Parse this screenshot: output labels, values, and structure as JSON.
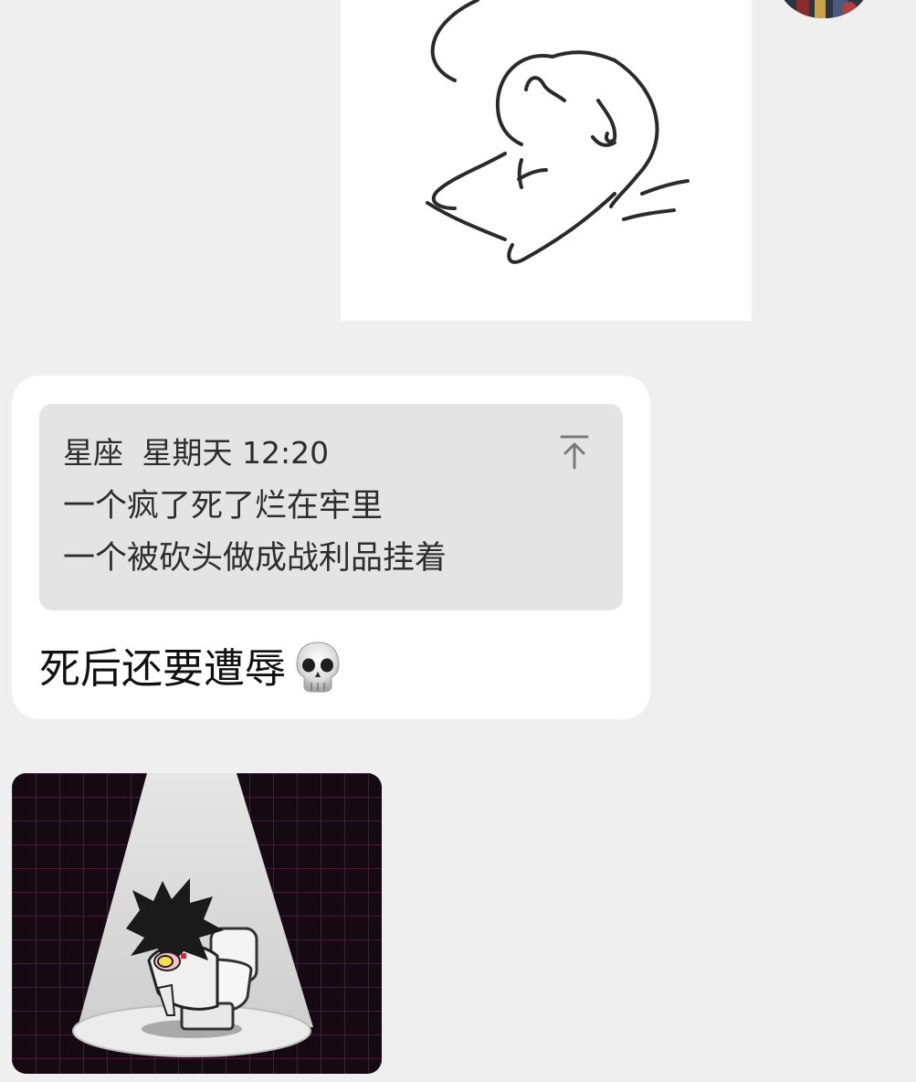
{
  "quote": {
    "sender": "星座",
    "time": "星期天 12:20",
    "line1": "一个疯了死了烂在牢里",
    "line2": "一个被砍头做成战利品挂着"
  },
  "message": {
    "text": "死后还要遭辱",
    "emoji": "skull"
  },
  "icons": {
    "jump_to_quote": "arrow-up-to-line-icon",
    "skull": "skull-emoji-icon"
  }
}
